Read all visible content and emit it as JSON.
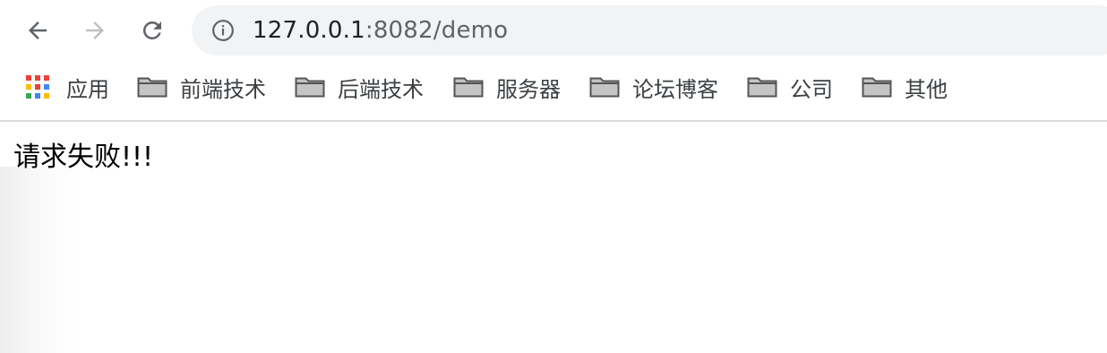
{
  "toolbar": {
    "back_icon": "arrow-left-icon",
    "forward_icon": "arrow-right-icon",
    "reload_icon": "reload-icon",
    "url_host": "127.0.0.1",
    "url_rest": ":8082/demo",
    "site_info_icon": "info-icon"
  },
  "bookmarks": {
    "apps_label": "应用",
    "items": [
      {
        "label": "前端技术",
        "icon": "folder-icon"
      },
      {
        "label": "后端技术",
        "icon": "folder-icon"
      },
      {
        "label": "服务器",
        "icon": "folder-icon"
      },
      {
        "label": "论坛博客",
        "icon": "folder-icon"
      },
      {
        "label": "公司",
        "icon": "folder-icon"
      },
      {
        "label": "其他",
        "icon": "folder-icon"
      }
    ]
  },
  "page": {
    "message": "请求失败!!!"
  },
  "colors": {
    "omnibox_bg": "#f1f3f4",
    "icon_gray": "#5f6368",
    "disabled_gray": "#9aa0a6"
  }
}
